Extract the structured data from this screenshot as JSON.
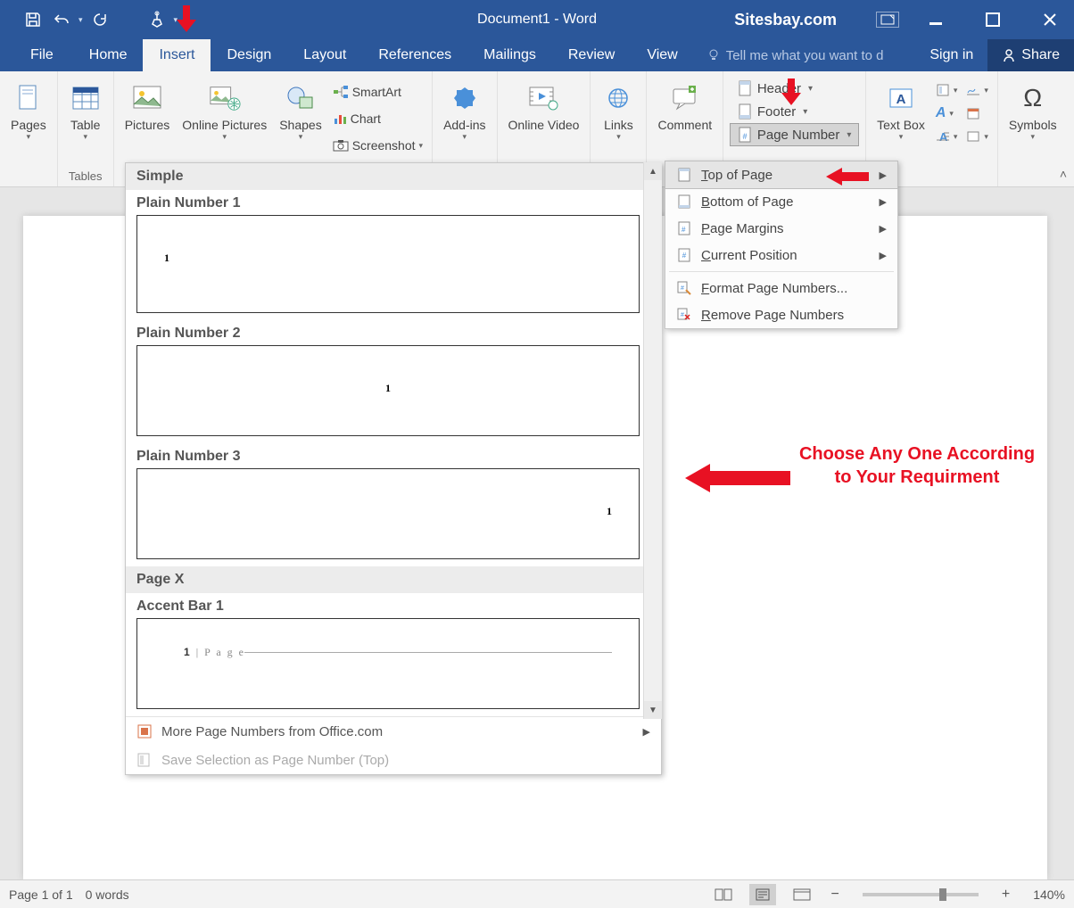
{
  "title": "Document1 - Word",
  "watermark": "Sitesbay.com",
  "tabs": [
    "File",
    "Home",
    "Insert",
    "Design",
    "Layout",
    "References",
    "Mailings",
    "Review",
    "View"
  ],
  "tellme_placeholder": "Tell me what you want to d",
  "signin": "Sign in",
  "share": "Share",
  "ribbon": {
    "pages": "Pages",
    "table": "Table",
    "tables_group": "Tables",
    "pictures": "Pictures",
    "online_pictures": "Online Pictures",
    "shapes": "Shapes",
    "smartart": "SmartArt",
    "chart": "Chart",
    "screenshot": "Screenshot",
    "addins": "Add-ins",
    "online_video": "Online Video",
    "links": "Links",
    "comment": "Comment",
    "header": "Header",
    "footer": "Footer",
    "page_number": "Page Number",
    "text_box": "Text Box",
    "symbols": "Symbols"
  },
  "submenu": {
    "top": "Top of Page",
    "bottom": "Bottom of Page",
    "margins": "Page Margins",
    "current": "Current Position",
    "format": "Format Page Numbers...",
    "remove": "Remove Page Numbers"
  },
  "gallery": {
    "simple": "Simple",
    "plain1": "Plain Number 1",
    "plain2": "Plain Number 2",
    "plain3": "Plain Number 3",
    "pagex": "Page X",
    "accent1": "Accent Bar 1",
    "sample_num": "1",
    "accent_text": "1 | P a g e",
    "more": "More Page Numbers from Office.com",
    "save_sel": "Save Selection as Page Number (Top)"
  },
  "annotation": "Choose Any One According to Your Requirment",
  "status": {
    "page": "Page 1 of 1",
    "words": "0 words",
    "zoom": "140%"
  }
}
